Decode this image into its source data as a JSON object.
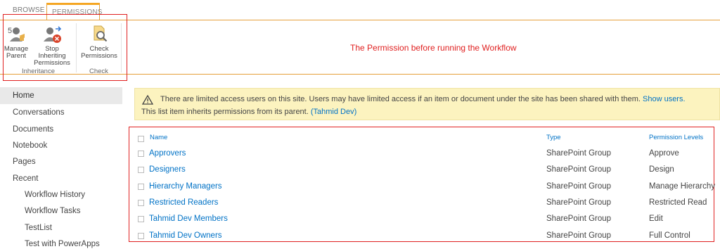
{
  "tabs": {
    "browse": "BROWSE",
    "permissions": "PERMISSIONS"
  },
  "ribbon": {
    "manage_parent": [
      "Manage",
      "Parent"
    ],
    "stop_inheriting": [
      "Stop Inheriting",
      "Permissions"
    ],
    "check_permissions": [
      "Check",
      "Permissions"
    ],
    "group_inheritance": "Inheritance",
    "group_check": "Check"
  },
  "annotation": "The Permission before running the Workflow",
  "nav": {
    "items": [
      "Home",
      "Conversations",
      "Documents",
      "Notebook",
      "Pages",
      "Recent",
      "Workflow History",
      "Workflow Tasks",
      "TestList",
      "Test with PowerApps"
    ]
  },
  "banner": {
    "line1": "There are limited access users on this site. Users may have limited access if an item or document under the site has been shared with them.",
    "line1_link": "Show users.",
    "line2": "This list item inherits permissions from its parent.",
    "line2_link": "(Tahmid Dev)"
  },
  "table": {
    "headers": {
      "name": "Name",
      "type": "Type",
      "levels": "Permission Levels"
    },
    "rows": [
      {
        "name": "Approvers",
        "type": "SharePoint Group",
        "level": "Approve"
      },
      {
        "name": "Designers",
        "type": "SharePoint Group",
        "level": "Design"
      },
      {
        "name": "Hierarchy Managers",
        "type": "SharePoint Group",
        "level": "Manage Hierarchy"
      },
      {
        "name": "Restricted Readers",
        "type": "SharePoint Group",
        "level": "Restricted Read"
      },
      {
        "name": "Tahmid Dev Members",
        "type": "SharePoint Group",
        "level": "Edit"
      },
      {
        "name": "Tahmid Dev Owners",
        "type": "SharePoint Group",
        "level": "Full Control"
      }
    ]
  },
  "colors": {
    "accent": "#f5a623",
    "link": "#0072c6",
    "annotation_red": "#e02020",
    "banner_bg": "#fcf3bf"
  }
}
